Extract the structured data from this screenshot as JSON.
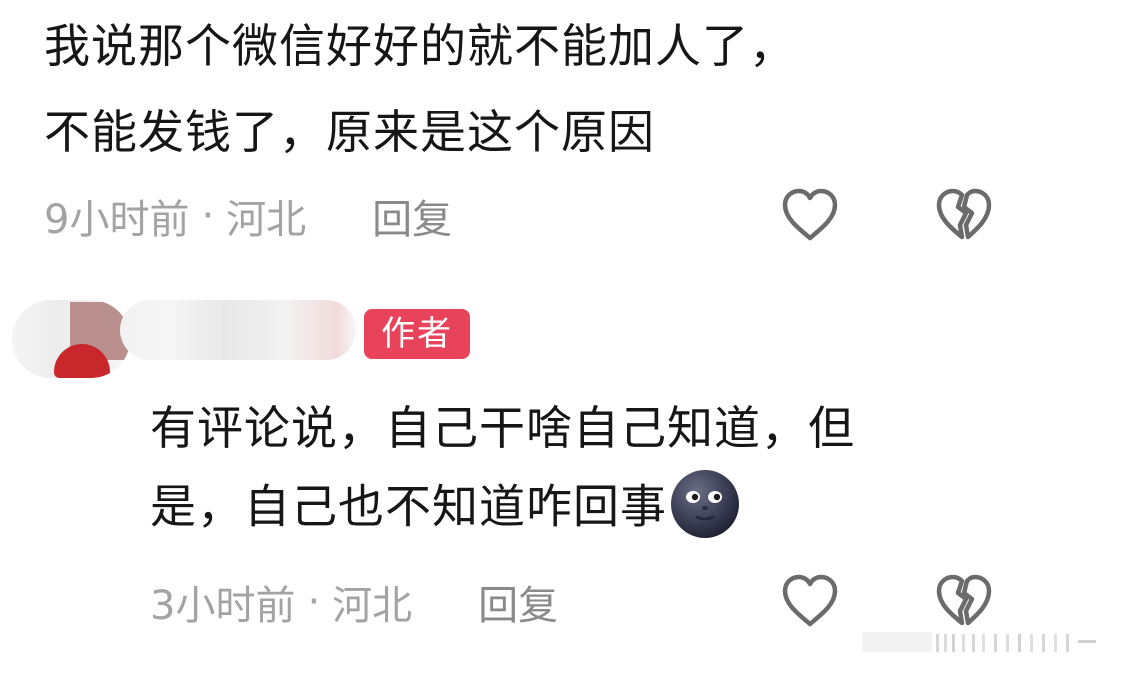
{
  "comment1": {
    "line1": "我说那个微信好好的就不能加人了，",
    "line2": "不能发钱了，原来是这个原因",
    "time": "9小时前",
    "separator": "·",
    "location": "河北",
    "reply_label": "回复"
  },
  "reply": {
    "author_badge": "作者",
    "line1": "有评论说，自己干啥自己知道，但",
    "line2": "是，自己也不知道咋回事",
    "emoji": "new-moon-face-emoji",
    "time": "3小时前",
    "separator": "·",
    "location": "河北",
    "reply_label": "回复"
  },
  "icons": {
    "like": "heart-outline-icon",
    "dislike": "broken-heart-icon"
  },
  "colors": {
    "badge": "#e8435a",
    "meta_text": "#a3a3a3",
    "icon_stroke": "#6b6b6b"
  }
}
